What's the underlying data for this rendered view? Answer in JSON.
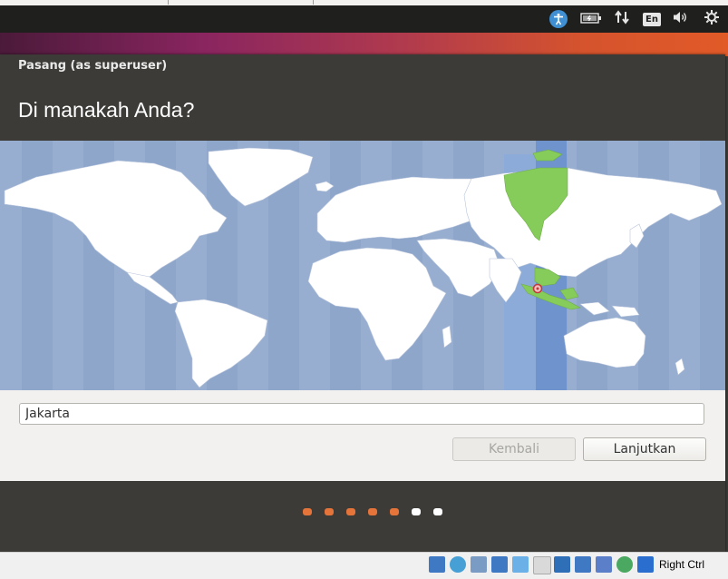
{
  "panel": {
    "accessibility_icon": "accessibility-icon",
    "battery_icon": "battery-icon",
    "network_icon": "network-arrows-icon",
    "language_indicator": "En",
    "volume_icon": "volume-icon",
    "settings_icon": "gear-icon"
  },
  "window": {
    "title": "Pasang (as superuser)",
    "heading": "Di manakah Anda?"
  },
  "map": {
    "selected_timezone_color": "#6f93cc",
    "highlight_land_color": "#86cc5a",
    "marker_city": "Jakarta"
  },
  "location": {
    "value": "Jakarta"
  },
  "buttons": {
    "back_label": "Kembali",
    "next_label": "Lanjutkan"
  },
  "progress": {
    "total_steps": 7,
    "completed_steps": 5,
    "done_color": "#e4743a",
    "pending_color": "#ffffff"
  },
  "statusbar": {
    "host_key_label": "Right Ctrl"
  }
}
